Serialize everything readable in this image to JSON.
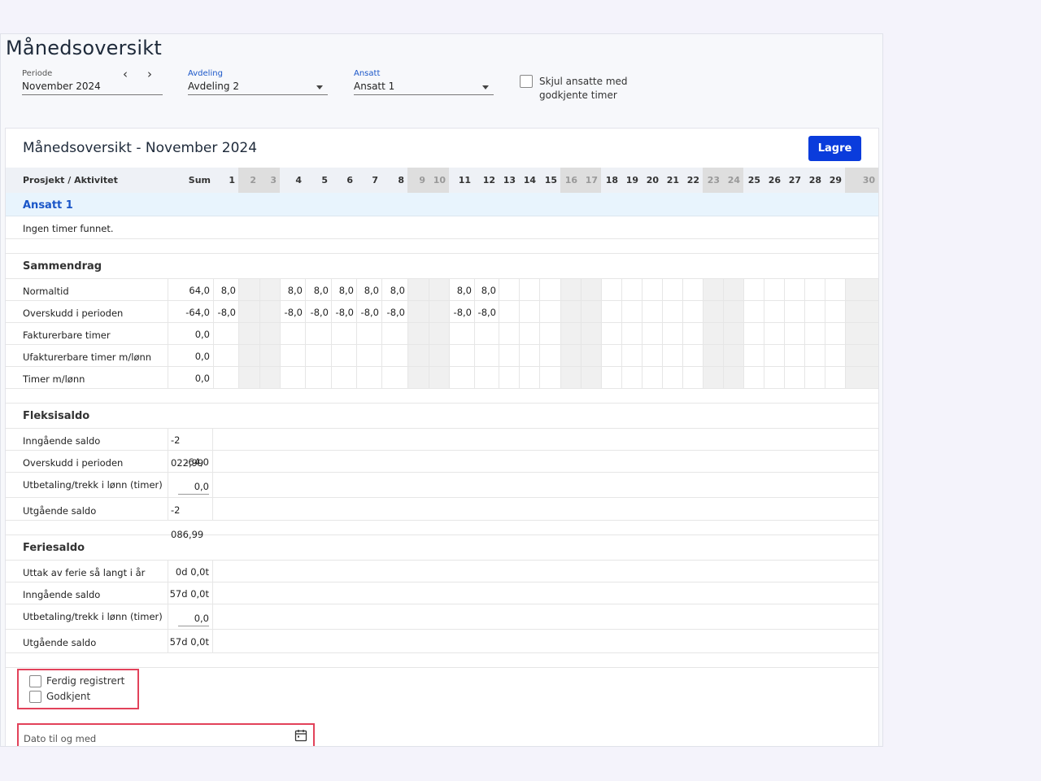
{
  "page_title": "Månedsoversikt",
  "filters": {
    "period": {
      "label": "Periode",
      "value": "November 2024"
    },
    "department": {
      "label": "Avdeling",
      "value": "Avdeling 2"
    },
    "employee": {
      "label": "Ansatt",
      "value": "Ansatt 1"
    },
    "hide_approved": {
      "label_line1": "Skjul ansatte med",
      "label_line2": "godkjente timer",
      "checked": false
    }
  },
  "card": {
    "title": "Månedsoversikt - November 2024",
    "save_label": "Lagre"
  },
  "table": {
    "col_project": "Prosjekt / Aktivitet",
    "col_sum": "Sum",
    "days": [
      "1",
      "2",
      "3",
      "4",
      "5",
      "6",
      "7",
      "8",
      "9",
      "10",
      "11",
      "12",
      "13",
      "14",
      "15",
      "16",
      "17",
      "18",
      "19",
      "20",
      "21",
      "22",
      "23",
      "24",
      "25",
      "26",
      "27",
      "28",
      "29",
      "30"
    ],
    "weekend_days": [
      "2",
      "3",
      "9",
      "10",
      "16",
      "17",
      "23",
      "24",
      "30"
    ],
    "employee_name": "Ansatt 1",
    "no_hours": "Ingen timer funnet."
  },
  "summary": {
    "heading": "Sammendrag",
    "rows": [
      {
        "label": "Normaltid",
        "sum": "64,0",
        "values": {
          "1": "8,0",
          "4": "8,0",
          "5": "8,0",
          "6": "8,0",
          "7": "8,0",
          "8": "8,0",
          "11": "8,0",
          "12": "8,0"
        }
      },
      {
        "label": "Overskudd i perioden",
        "sum": "-64,0",
        "values": {
          "1": "-8,0",
          "4": "-8,0",
          "5": "-8,0",
          "6": "-8,0",
          "7": "-8,0",
          "8": "-8,0",
          "11": "-8,0",
          "12": "-8,0"
        }
      },
      {
        "label": "Fakturerbare timer",
        "sum": "0,0",
        "values": {}
      },
      {
        "label": "Ufakturerbare timer m/lønn",
        "sum": "0,0",
        "values": {}
      },
      {
        "label": "Timer m/lønn",
        "sum": "0,0",
        "values": {}
      }
    ]
  },
  "flex": {
    "heading": "Fleksisaldo",
    "opening_label": "Inngående saldo",
    "opening": "-2 022,99",
    "period_label": "Overskudd i perioden",
    "period": "-64,0",
    "payout_label": "Utbetaling/trekk i lønn (timer)",
    "payout": "0,0",
    "closing_label": "Utgående saldo",
    "closing": "-2 086,99"
  },
  "vacation": {
    "heading": "Feriesaldo",
    "taken_label": "Uttak av ferie så langt i år",
    "taken": "0d 0,0t",
    "opening_label": "Inngående saldo",
    "opening": "57d 0,0t",
    "payout_label": "Utbetaling/trekk i lønn (timer)",
    "payout": "0,0",
    "closing_label": "Utgående saldo",
    "closing": "57d 0,0t"
  },
  "status": {
    "done_label": "Ferdig registrert",
    "approved_label": "Godkjent",
    "date_placeholder": "Dato til og med"
  }
}
